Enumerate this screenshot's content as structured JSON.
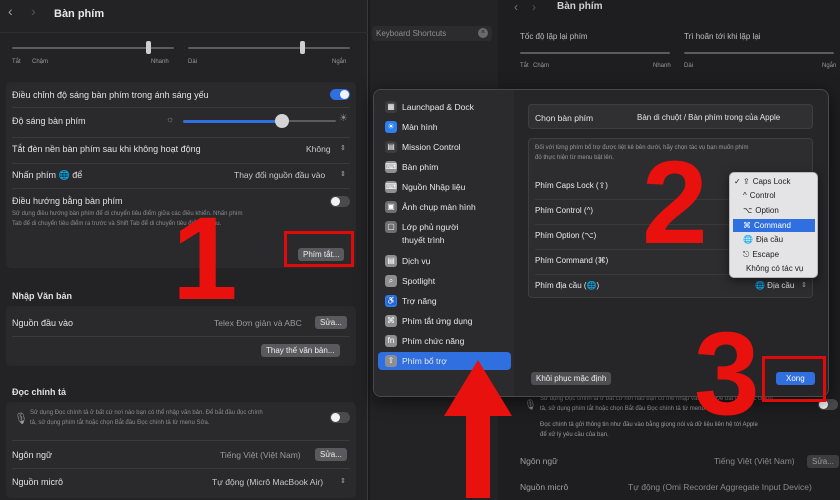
{
  "left": {
    "title": "Bàn phím",
    "speed": {
      "min": "Tắt",
      "min2": "Chậm",
      "max": "Nhanh"
    },
    "delay": {
      "min": "Dài",
      "max": "Ngắn"
    },
    "backlight_label": "Điều chỉnh độ sáng bàn phím trong ánh sáng yếu",
    "brightness_label": "Độ sáng bàn phím",
    "turnoff_label": "Tắt đèn nền bàn phím sau khi không hoạt động",
    "turnoff_value": "Không",
    "press_label": "Nhấn phím 🌐 để",
    "press_value": "Thay đổi nguồn đầu vào",
    "nav_label": "Điều hướng bằng bàn phím",
    "nav_desc1": "Sử dụng điều hướng bàn phím để di chuyển tiêu điểm giữa các điều khiển. Nhấn phím",
    "nav_desc2": "Tab để di chuyển tiêu điểm ra trước và Shift Tab để di chuyển tiêu điểm ra sau.",
    "shortcuts_btn": "Phím tắt...",
    "text_input_header": "Nhập Văn bản",
    "input_source_label": "Nguồn đầu vào",
    "input_source_value": "Telex Đơn giản và ABC",
    "edit_btn": "Sửa...",
    "replace_btn": "Thay thế văn bản...",
    "dictation_header": "Đọc chính tả",
    "dict_desc1": "Sử dụng Đọc chính tả ở bất cứ nơi nào bạn có thể nhập văn bản. Để bắt đầu đọc chính",
    "dict_desc2": "tả, sử dụng phím tắt hoặc chọn Bắt đầu Đọc chính tả từ menu Sửa.",
    "lang_label": "Ngôn ngữ",
    "lang_value": "Tiếng Việt (Việt Nam)",
    "mic_label": "Nguồn micrô",
    "mic_value": "Tự động (Micrô MacBook Air)"
  },
  "bg": {
    "search": "Keyboard Shortcuts",
    "title": "Bàn phím",
    "repeat": "Tốc độ lặp lại phím",
    "delay": "Trì hoãn tới khi lặp lại",
    "off": "Tắt",
    "slow": "Chậm",
    "fast": "Nhanh",
    "long": "Dài",
    "short": "Ngắn",
    "dict1": "Sử dụng Đọc chính tả ở bất cứ nơi nào bạn có thể nhập văn bản. Để bắt đầu đọc chính",
    "dict2": "tả, sử dụng phím tắt hoặc chọn Bắt đầu Đọc chính tả từ menu Sửa.",
    "dict3": "Đọc chính tả gửi thông tin như đầu vào bằng giọng nói và dữ liệu liên hệ tới Apple",
    "dict4": "để xử lý yêu cầu của bạn.",
    "lang_label": "Ngôn ngữ",
    "lang_value": "Tiếng Việt (Việt Nam)",
    "edit": "Sửa...",
    "mic_label": "Nguồn micrô",
    "mic_value": "Tự động (Omi Recorder Aggregate Input Device)"
  },
  "dialog": {
    "sidebar": [
      {
        "label": "Launchpad & Dock",
        "icon": "launchpad-icon",
        "color": "#3b3b40",
        "glyph": "▦"
      },
      {
        "label": "Màn hình",
        "icon": "display-icon",
        "color": "#2d7ff0",
        "glyph": "☀"
      },
      {
        "label": "Mission Control",
        "icon": "mission-control-icon",
        "color": "#3b3b40",
        "glyph": "▤"
      },
      {
        "label": "Bàn phím",
        "icon": "keyboard-icon",
        "color": "#8e8e93",
        "glyph": "⌨"
      },
      {
        "label": "Nguồn Nhập liệu",
        "icon": "input-sources-icon",
        "color": "#8e8e93",
        "glyph": "⌨"
      },
      {
        "label": "Ảnh chụp màn hình",
        "icon": "screenshot-icon",
        "color": "#6e6e73",
        "glyph": "▣"
      },
      {
        "label": "Lớp phủ người",
        "icon": "presenter-overlay-icon",
        "color": "#6e6e73",
        "glyph": "▢"
      },
      {
        "label": "Dịch vụ",
        "icon": "services-icon",
        "color": "#8e8e93",
        "glyph": "▤"
      },
      {
        "label": "Spotlight",
        "icon": "spotlight-icon",
        "color": "#8e8e93",
        "glyph": "⌕"
      },
      {
        "label": "Trợ năng",
        "icon": "accessibility-icon",
        "color": "#2d7ff0",
        "glyph": "♿"
      },
      {
        "label": "Phím tắt ứng dụng",
        "icon": "app-shortcuts-icon",
        "color": "#8e8e93",
        "glyph": "⌘"
      },
      {
        "label": "Phím chức năng",
        "icon": "function-keys-icon",
        "color": "#8e8e93",
        "glyph": "fn"
      },
      {
        "label": "Phím bổ trợ",
        "icon": "modifier-keys-icon",
        "color": "#8e8e93",
        "glyph": "⇧"
      }
    ],
    "sidebar_item6_line2": "thuyết trình",
    "select_kb_label": "Chọn bàn phím",
    "select_kb_value": "Bàn di chuột / Bàn phím trong của Apple",
    "desc1": "Đối với từng phím bổ trợ được liệt kê bên dưới, hãy chọn tác vụ bạn muốn phím",
    "desc2": "đó thực hiện từ menu bật lên.",
    "rows": [
      "Phím Caps Lock (⇪)",
      "Phím Control (^)",
      "Phím Option (⌥)",
      "Phím Command (⌘)",
      "Phím địa cầu (🌐)"
    ],
    "globe_value": "🌐 Địa cầu",
    "menu": [
      "Caps Lock",
      "Control",
      "Option",
      "Command",
      "Địa cầu",
      "Escape",
      "Không có tác vụ"
    ],
    "menu_checked": "✓",
    "menu_glyphs": [
      "⇪",
      "^",
      "⌥",
      "⌘",
      "🌐",
      "⎋",
      ""
    ],
    "menu_selected_index": 3,
    "restore_btn": "Khôi phục mặc định",
    "done_btn": "Xong"
  },
  "annotations": [
    "1",
    "2",
    "3"
  ]
}
